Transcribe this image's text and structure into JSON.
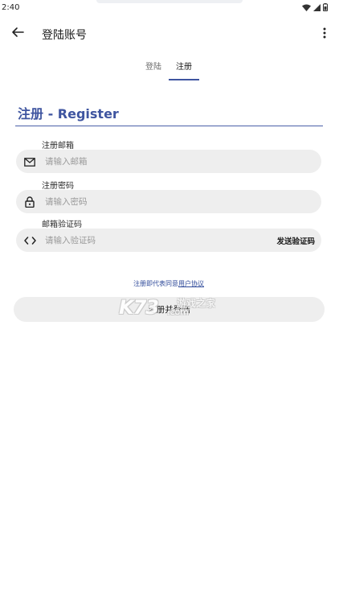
{
  "status_bar": {
    "time": "2:40",
    "icons": [
      "wifi-icon",
      "signal-icon",
      "battery-icon"
    ]
  },
  "app_bar": {
    "title": "登陆账号",
    "back_icon": "arrow-left-icon",
    "menu_icon": "more-vert-icon"
  },
  "tabs": [
    {
      "label": "登陆",
      "selected": false
    },
    {
      "label": "注册",
      "selected": true
    }
  ],
  "form": {
    "heading": "注册 - Register",
    "email": {
      "label": "注册邮箱",
      "placeholder": "请输入邮箱",
      "value": "",
      "icon": "mail-icon"
    },
    "password": {
      "label": "注册密码",
      "placeholder": "请输入密码",
      "value": "",
      "icon": "lock-icon"
    },
    "code": {
      "label": "邮箱验证码",
      "placeholder": "请输入验证码",
      "value": "",
      "icon": "code-icon",
      "send_label": "发送验证码"
    },
    "agreement_prefix": "注册即代表同意",
    "agreement_link": "用户协议",
    "submit_label": "注册并登陆"
  },
  "watermark": {
    "logo": "K73",
    "text": "游戏之家",
    "domain": ".com"
  },
  "colors": {
    "accent": "#3f55a0",
    "field_bg": "#eeeeee",
    "link": "#2f4a9a"
  }
}
